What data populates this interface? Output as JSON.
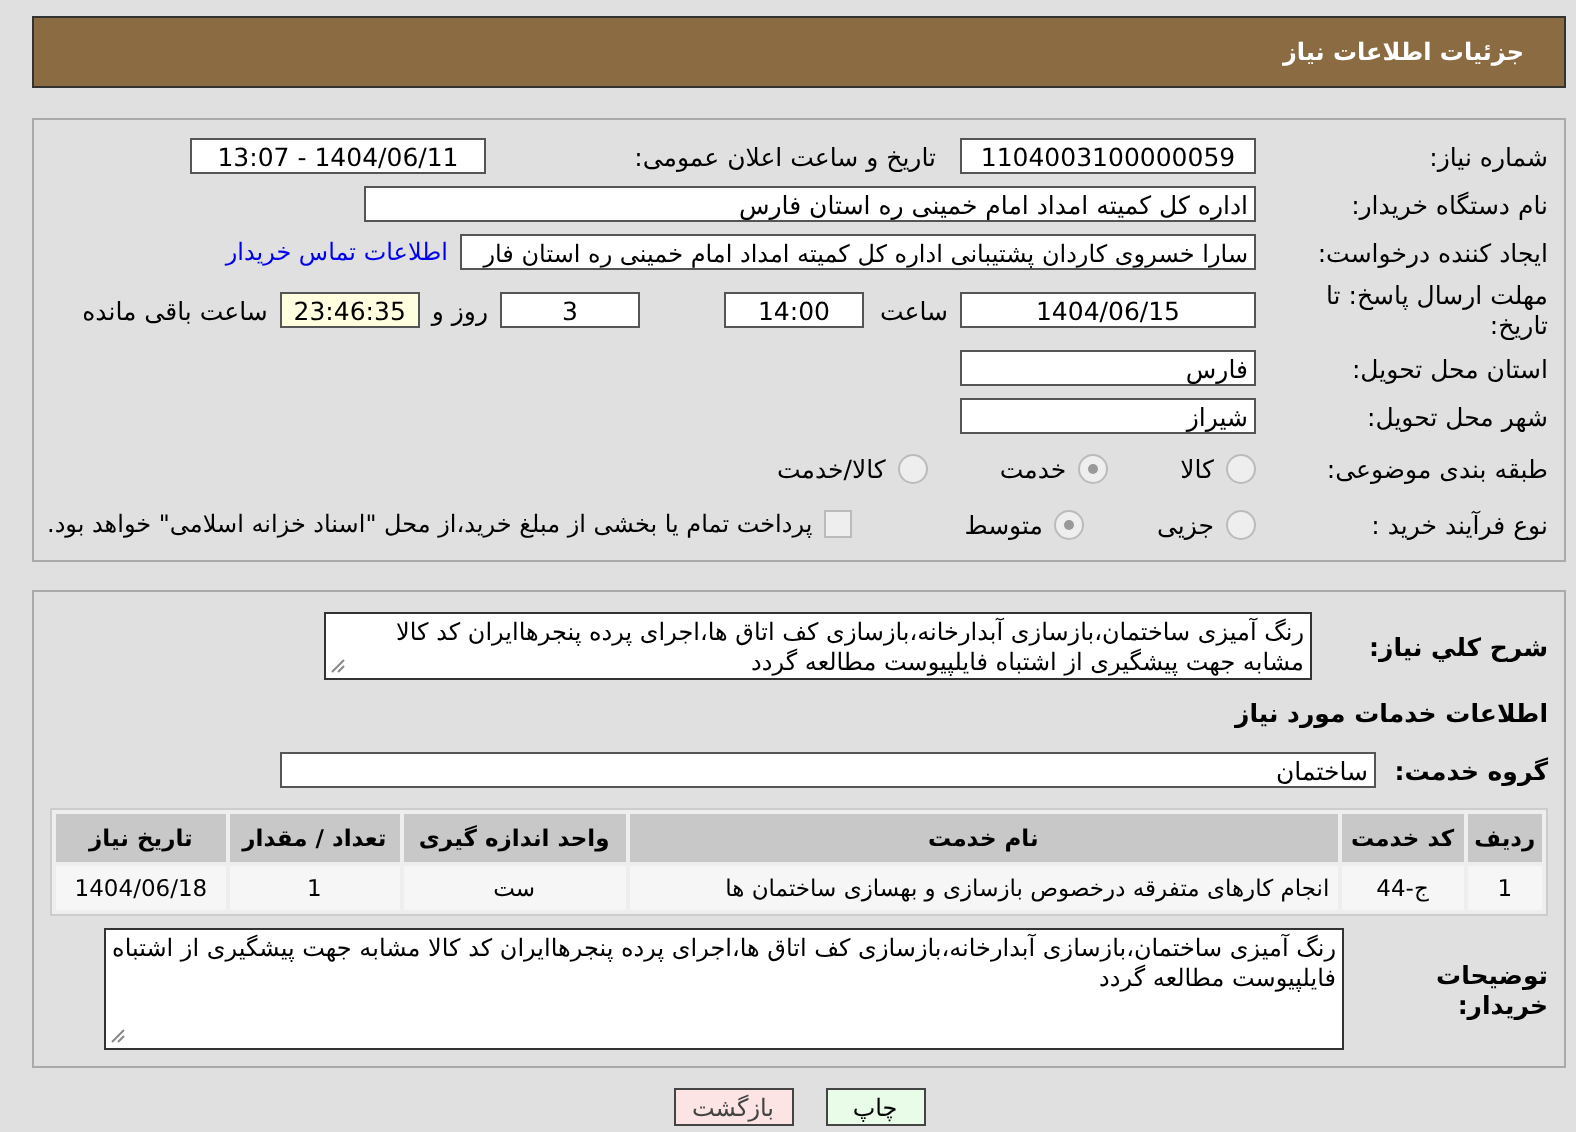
{
  "header": {
    "title": "جزئیات اطلاعات نیاز"
  },
  "need_number": {
    "label": "شماره نیاز:",
    "value": "1104003100000059"
  },
  "announce_date": {
    "label": "تاریخ و ساعت اعلان عمومی:",
    "value": "1404/06/11 - 13:07"
  },
  "buyer_org": {
    "label": "نام دستگاه خریدار:",
    "value": "اداره کل کمیته امداد امام خمینی  ره  استان فارس"
  },
  "requester": {
    "label": "ایجاد کننده درخواست:",
    "value": "سارا خسروی کاردان پشتیبانی  اداره کل کمیته امداد امام خمینی  ره  استان فار",
    "link": "اطلاعات تماس خریدار"
  },
  "deadline": {
    "label": "مهلت ارسال پاسخ: تا تاریخ:",
    "date": "1404/06/15",
    "time_label": "ساعت",
    "time": "14:00",
    "days": "3",
    "days_label": "روز و",
    "remaining": "23:46:35",
    "remaining_label": "ساعت باقی مانده"
  },
  "province": {
    "label": "استان محل تحویل:",
    "value": "فارس"
  },
  "city": {
    "label": "شهر محل تحویل:",
    "value": "شیراز"
  },
  "category": {
    "label": "طبقه بندی موضوعی:",
    "options": [
      {
        "label": "کالا",
        "selected": false
      },
      {
        "label": "خدمت",
        "selected": true
      },
      {
        "label": "کالا/خدمت",
        "selected": false
      }
    ]
  },
  "process": {
    "label": "نوع فرآیند خرید :",
    "options": [
      {
        "label": "جزیی",
        "selected": false
      },
      {
        "label": "متوسط",
        "selected": true
      }
    ],
    "payment": {
      "checked": false,
      "text": "پرداخت تمام یا بخشی از مبلغ خرید،از محل \"اسناد خزانه اسلامی\" خواهد بود."
    }
  },
  "summary": {
    "label": "شرح کلي نیاز:",
    "value": "رنگ آمیزی ساختمان،بازسازی آبدارخانه،بازسازی کف اتاق ها،اجرای پرده پنجرهاایران کد کالا مشابه جهت پیشگیری از اشتباه فایلپیوست مطالعه گردد"
  },
  "services_title": "اطلاعات خدمات مورد نیاز",
  "service_group": {
    "label": "گروه خدمت:",
    "value": "ساختمان"
  },
  "table": {
    "columns": [
      "ردیف",
      "کد خدمت",
      "نام خدمت",
      "واحد اندازه گیری",
      "تعداد / مقدار",
      "تاریخ نیاز"
    ],
    "rows": [
      [
        "1",
        "ج-44",
        "انجام کارهای متفرقه درخصوص بازسازی و بهسازی ساختمان ها",
        "ست",
        "1",
        "1404/06/18"
      ]
    ]
  },
  "buyer_notes": {
    "label": "توضیحات خریدار:",
    "value": "رنگ آمیزی ساختمان،بازسازی آبدارخانه،بازسازی کف اتاق ها،اجرای پرده پنجرهاایران کد کالا مشابه جهت پیشگیری از اشتباه فایلپیوست مطالعه گردد"
  },
  "buttons": [
    {
      "label": "چاپ",
      "kind": "print"
    },
    {
      "label": "بازگشت",
      "kind": "back"
    }
  ]
}
